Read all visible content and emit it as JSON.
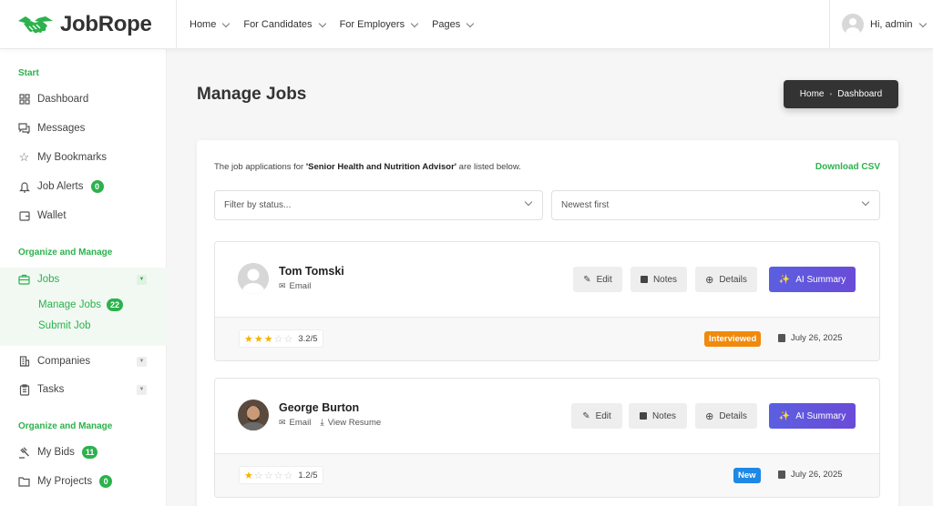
{
  "brand": {
    "name": "JobRope",
    "accent": "#2bb24c"
  },
  "topnav": {
    "items": [
      {
        "label": "Home"
      },
      {
        "label": "For Candidates"
      },
      {
        "label": "For Employers"
      },
      {
        "label": "Pages"
      }
    ],
    "user_greeting": "Hi, admin"
  },
  "sidebar": {
    "section_start": "Start",
    "dashboard": "Dashboard",
    "messages": "Messages",
    "bookmarks": "My Bookmarks",
    "job_alerts": "Job Alerts",
    "job_alerts_count": "0",
    "wallet": "Wallet",
    "section_organize": "Organize and Manage",
    "jobs": "Jobs",
    "manage_jobs": "Manage Jobs",
    "manage_jobs_count": "22",
    "submit_job": "Submit Job",
    "companies": "Companies",
    "tasks": "Tasks",
    "section_organize2": "Organize and Manage",
    "my_bids": "My Bids",
    "my_bids_count": "11",
    "my_projects": "My Projects",
    "my_projects_count": "0"
  },
  "page": {
    "title": "Manage Jobs",
    "breadcrumb": [
      "Home",
      "Dashboard"
    ]
  },
  "panel": {
    "intro_prefix": "The job applications for ",
    "job_title": "'Senior Health and Nutrition Advisor'",
    "intro_suffix": " are listed below.",
    "download": "Download CSV",
    "filter_placeholder": "Filter by status...",
    "sort_value": "Newest first"
  },
  "buttons": {
    "edit": "Edit",
    "notes": "Notes",
    "details": "Details",
    "ai": "AI Summary"
  },
  "applicants": [
    {
      "name": "Tom Tomski",
      "email": "Email",
      "resume": "",
      "rating": 3.2,
      "rating_text": "3.2/5",
      "status": "Interviewed",
      "status_color": "#f08a0c",
      "date": "July 26, 2025"
    },
    {
      "name": "George Burton",
      "email": "Email",
      "resume": "View Resume",
      "rating": 1.2,
      "rating_text": "1.2/5",
      "status": "New",
      "status_color": "#1e88e5",
      "date": "July 26, 2025"
    }
  ]
}
